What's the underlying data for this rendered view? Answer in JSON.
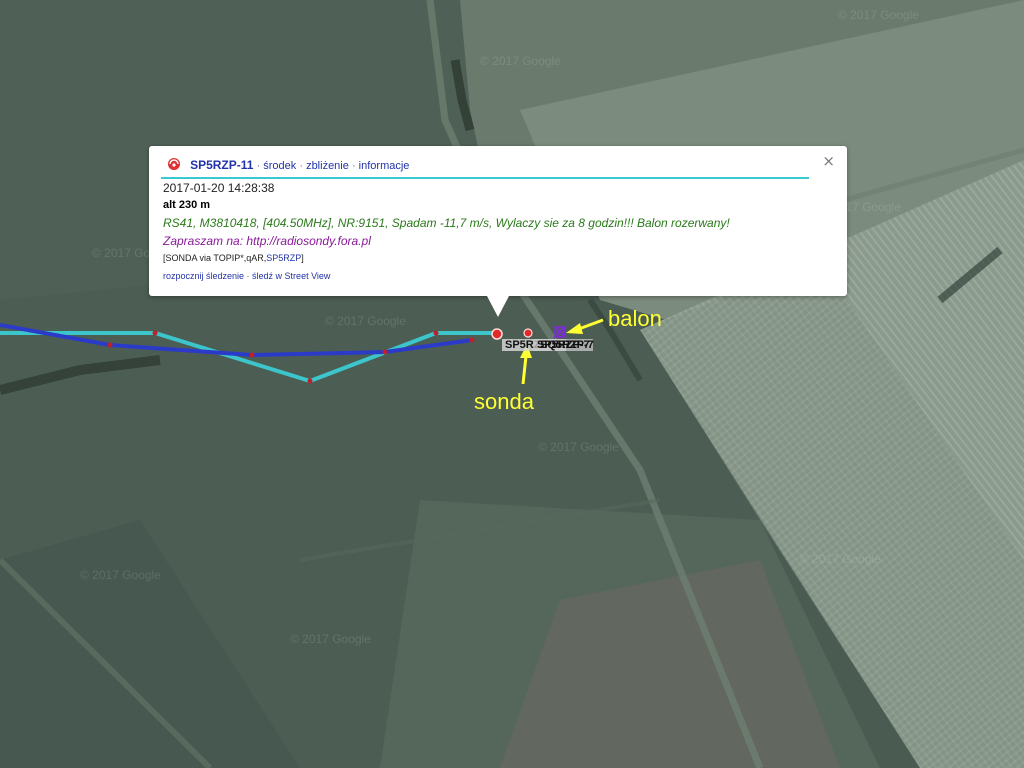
{
  "map": {
    "watermark_text": "© 2017 Google",
    "track_colors": {
      "cyan": "#3cc6cc",
      "blue": "#2b3bc8",
      "vertex": "#c0202a"
    }
  },
  "popup": {
    "icon": "aprs-symbol-icon",
    "callsign": "SP5RZP-11",
    "links": [
      "środek",
      "zbliżenie",
      "informacje"
    ],
    "sep": " · ",
    "timestamp": "2017-01-20 14:28:38",
    "altitude": "alt 230 m",
    "comment": "RS41, M3810418, [404.50MHz], NR:9151, Spadam -11,7 m/s, Wylaczy sie za 8 godzin!!! Balon rozerwany!",
    "invite_prefix": "Zapraszam na: ",
    "invite_url": "http://radiosondy.fora.pl",
    "path_prefix": "[SONDA via TOPIP*,qAR,",
    "path_link": "SP5RZP",
    "path_suffix": "]",
    "actions": [
      "rozpocznij śledzenie",
      "śledź w Street View"
    ],
    "close_label": "×"
  },
  "labels": {
    "station1": "SP5RZP-11",
    "station2": "SQ5RZP-7",
    "station3": "SP5RZP-7"
  },
  "annotations": {
    "balon": "balon",
    "sonda": "sonda"
  }
}
